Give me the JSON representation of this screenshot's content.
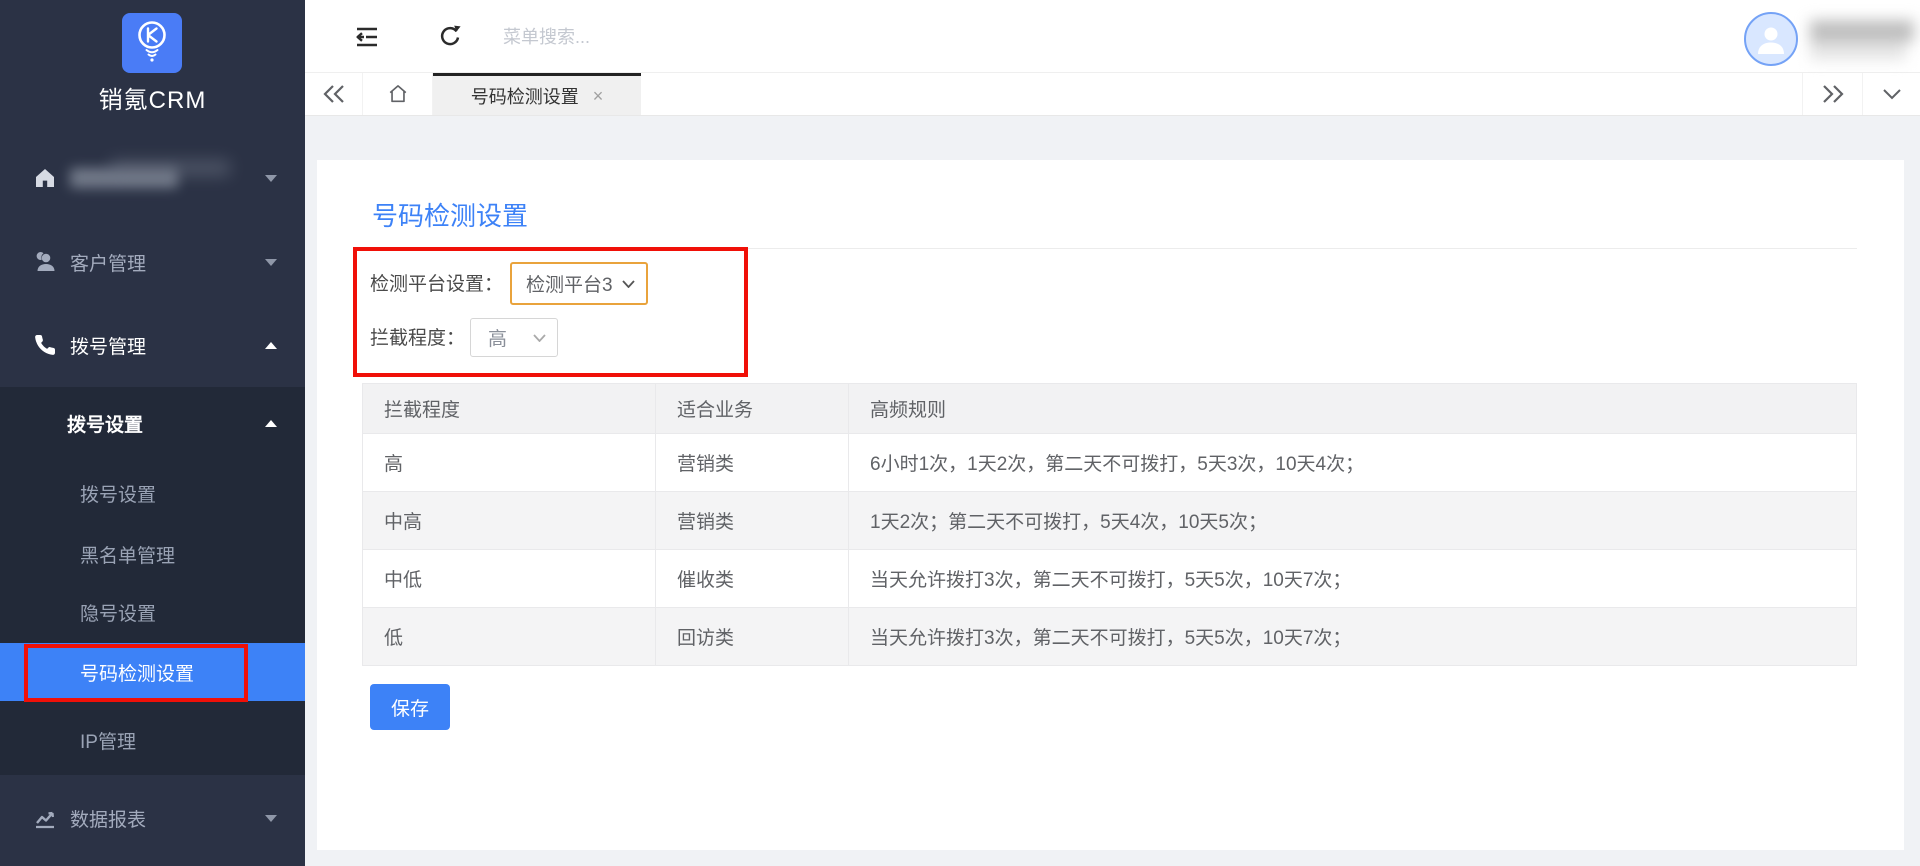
{
  "brand": {
    "name": "销氪CRM"
  },
  "colors": {
    "accent_blue": "#3D82F7",
    "annotation_red": "#F01008",
    "sidebar_bg": "#2B3245",
    "sidebar_submenu_bg": "#222938",
    "select_focus_border": "#E9A33C"
  },
  "sidebar": {
    "items": [
      {
        "id": "home",
        "redacted": true,
        "caret": "down"
      },
      {
        "id": "customers",
        "label": "客户管理",
        "caret": "down"
      },
      {
        "id": "dialing",
        "label": "拨号管理",
        "caret": "up",
        "expanded": true
      }
    ],
    "submenu": {
      "header": {
        "label": "拨号设置",
        "caret": "up"
      },
      "items": [
        {
          "label": "拨号设置"
        },
        {
          "label": "黑名单管理"
        },
        {
          "label": "隐号设置"
        },
        {
          "label": "号码检测设置",
          "active": true
        },
        {
          "label": "IP管理"
        }
      ]
    },
    "report_item": {
      "label": "数据报表",
      "caret": "down"
    }
  },
  "topbar": {
    "search_placeholder": "菜单搜索..."
  },
  "tabbar": {
    "active_tab": "号码检测设置",
    "close_glyph": "×"
  },
  "page": {
    "title": "号码检测设置",
    "form": {
      "platform_label": "检测平台设置：",
      "platform_value": "检测平台3",
      "level_label": "拦截程度：",
      "level_value": "高"
    },
    "table": {
      "headers": [
        "拦截程度",
        "适合业务",
        "高频规则"
      ],
      "rows": [
        [
          "高",
          "营销类",
          "6小时1次，1天2次，第二天不可拨打，5天3次，10天4次；"
        ],
        [
          "中高",
          "营销类",
          "1天2次；第二天不可拨打，5天4次，10天5次；"
        ],
        [
          "中低",
          "催收类",
          "当天允许拨打3次，第二天不可拨打，5天5次，10天7次；"
        ],
        [
          "低",
          "回访类",
          "当天允许拨打3次，第二天不可拨打，5天5次，10天7次；"
        ]
      ]
    },
    "save_label": "保存"
  }
}
